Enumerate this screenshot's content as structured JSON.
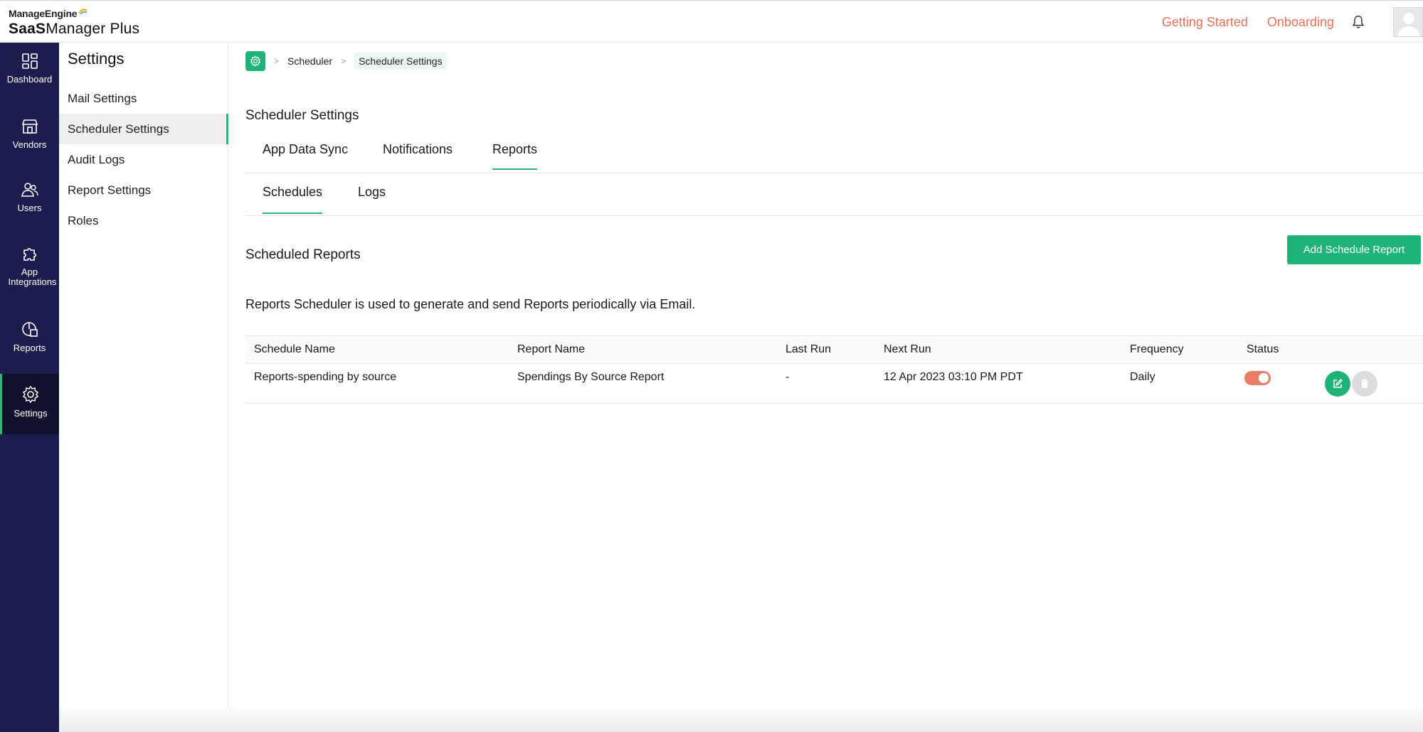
{
  "header": {
    "brand_top": "ManageEngine",
    "product_bold": "SaaS",
    "product_rest": "Manager Plus",
    "links": [
      "Getting Started",
      "Onboarding"
    ],
    "accent_color": "#e7725a"
  },
  "leftnav": {
    "items": [
      {
        "label": "Dashboard",
        "icon": "dashboard-icon"
      },
      {
        "label": "Vendors",
        "icon": "store-icon"
      },
      {
        "label": "Users",
        "icon": "users-icon"
      },
      {
        "label": "App Integrations",
        "icon": "puzzle-icon"
      },
      {
        "label": "Reports",
        "icon": "reports-icon"
      },
      {
        "label": "Settings",
        "icon": "gear-icon",
        "active": true
      }
    ],
    "bg_color": "#1d1d4d",
    "active_color": "#2bb673"
  },
  "subpanel": {
    "title": "Settings",
    "items": [
      {
        "label": "Mail Settings"
      },
      {
        "label": "Scheduler Settings",
        "active": true
      },
      {
        "label": "Audit Logs"
      },
      {
        "label": "Report Settings"
      },
      {
        "label": "Roles"
      }
    ]
  },
  "breadcrumb": {
    "items": [
      "Scheduler",
      "Scheduler Settings"
    ],
    "separator": ">"
  },
  "main": {
    "page_title": "Scheduler Settings",
    "tabs": [
      {
        "label": "App Data Sync"
      },
      {
        "label": "Notifications"
      },
      {
        "label": "Reports",
        "active": true
      }
    ],
    "subtabs": [
      {
        "label": "Schedules",
        "active": true
      },
      {
        "label": "Logs"
      }
    ],
    "section_title": "Scheduled Reports",
    "add_button": "Add Schedule Report",
    "description": "Reports Scheduler is used to generate and send Reports periodically via Email."
  },
  "table": {
    "columns": [
      "Schedule Name",
      "Report Name",
      "Last Run",
      "Next Run",
      "Frequency",
      "Status"
    ],
    "rows": [
      {
        "schedule_name": "Reports-spending by source",
        "report_name": "Spendings By Source Report",
        "last_run": "-",
        "next_run": "12 Apr 2023 03:10 PM PDT",
        "frequency": "Daily",
        "status_on": true
      }
    ]
  },
  "colors": {
    "primary_green": "#1fb37a",
    "toggle_on": "#e97d65"
  }
}
